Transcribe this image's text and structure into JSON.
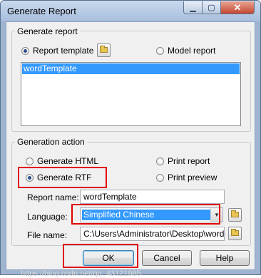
{
  "window": {
    "title": "Generate Report",
    "minimize_icon": "minimize-icon",
    "maximize_icon": "maximize-icon",
    "close_icon": "close-icon"
  },
  "generate_report": {
    "group_label": "Generate report",
    "report_template_label": "Report template",
    "model_report_label": "Model report",
    "selected_source": "Report template",
    "list_items": [
      "wordTemplate"
    ]
  },
  "generation_action": {
    "group_label": "Generation action",
    "options": {
      "html": "Generate HTML",
      "rtf": "Generate RTF",
      "print_report": "Print report",
      "print_preview": "Print preview"
    },
    "selected": "Generate RTF",
    "report_name_label": "Report name:",
    "report_name_value": "wordTemplate",
    "language_label": "Language:",
    "language_value": "Simplified Chinese",
    "file_name_label": "File name:",
    "file_name_value": "C:\\Users\\Administrator\\Desktop\\wordTen"
  },
  "buttons": {
    "ok": "OK",
    "cancel": "Cancel",
    "help": "Help"
  },
  "watermark": "https://blog.csdn.net/qq_43121985",
  "colors": {
    "highlight_box": "#e00000",
    "selection": "#3399ff",
    "titlebar": "#b7cbe4"
  }
}
